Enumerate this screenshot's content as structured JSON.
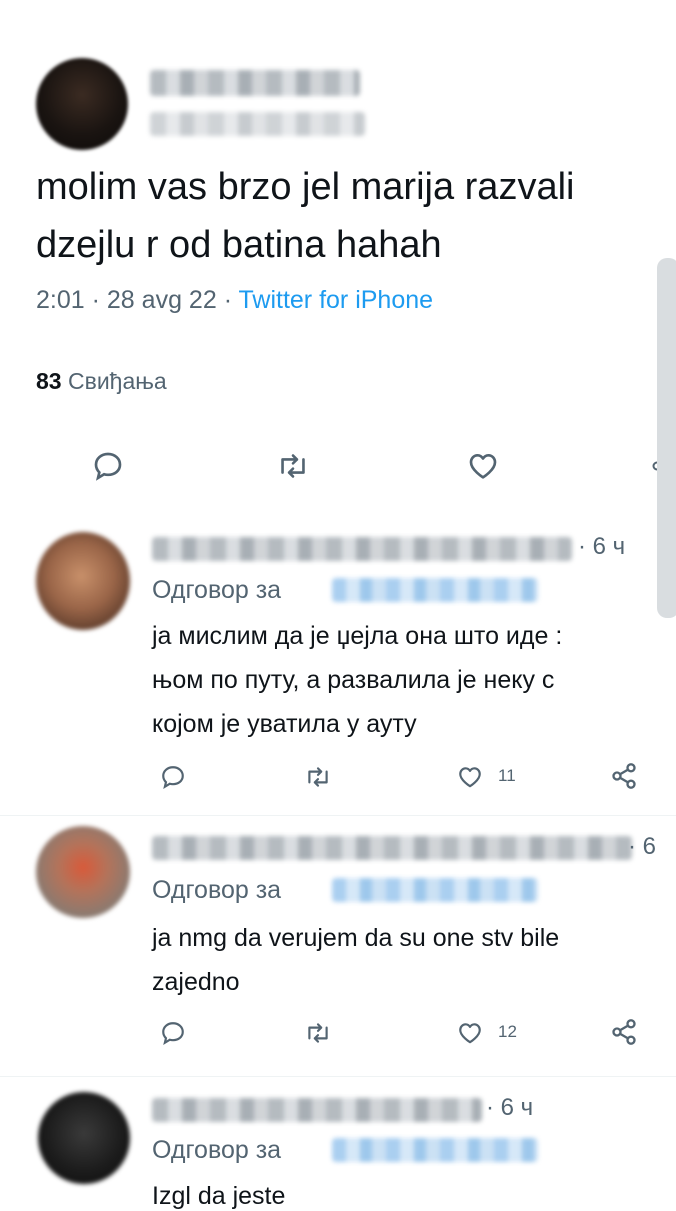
{
  "main_tweet": {
    "text_line1": "molim vas brzo jel marija razvali",
    "text_line2": "dzejlu r od batina hahah",
    "time": "2:01",
    "sep1": "·",
    "date": "28 avg 22",
    "sep2": "·",
    "source": "Twitter for iPhone",
    "likes_count": "83",
    "likes_label": "Свиђања"
  },
  "replies": [
    {
      "age": "· 6 ч",
      "reply_to_label": "Одговор за",
      "text_line1": "ја мислим да је џејла она што иде :",
      "text_line2": "њом по путу, а развалила је неку с",
      "text_line3": "којом је уватила у ауту",
      "like_count": "11"
    },
    {
      "age": "· 6",
      "reply_to_label": "Одговор за",
      "text_line1": "ja nmg da verujem da su one stv bile",
      "text_line2": "zajedno",
      "like_count": "12"
    },
    {
      "age": "· 6 ч",
      "reply_to_label": "Одговор за",
      "text_line1": "Izgl da jeste"
    }
  ],
  "icons": [
    "reply-icon",
    "retweet-icon",
    "like-icon",
    "share-icon"
  ],
  "colors": {
    "link": "#1d9bf0",
    "muted": "#536471",
    "text": "#0f1419"
  }
}
